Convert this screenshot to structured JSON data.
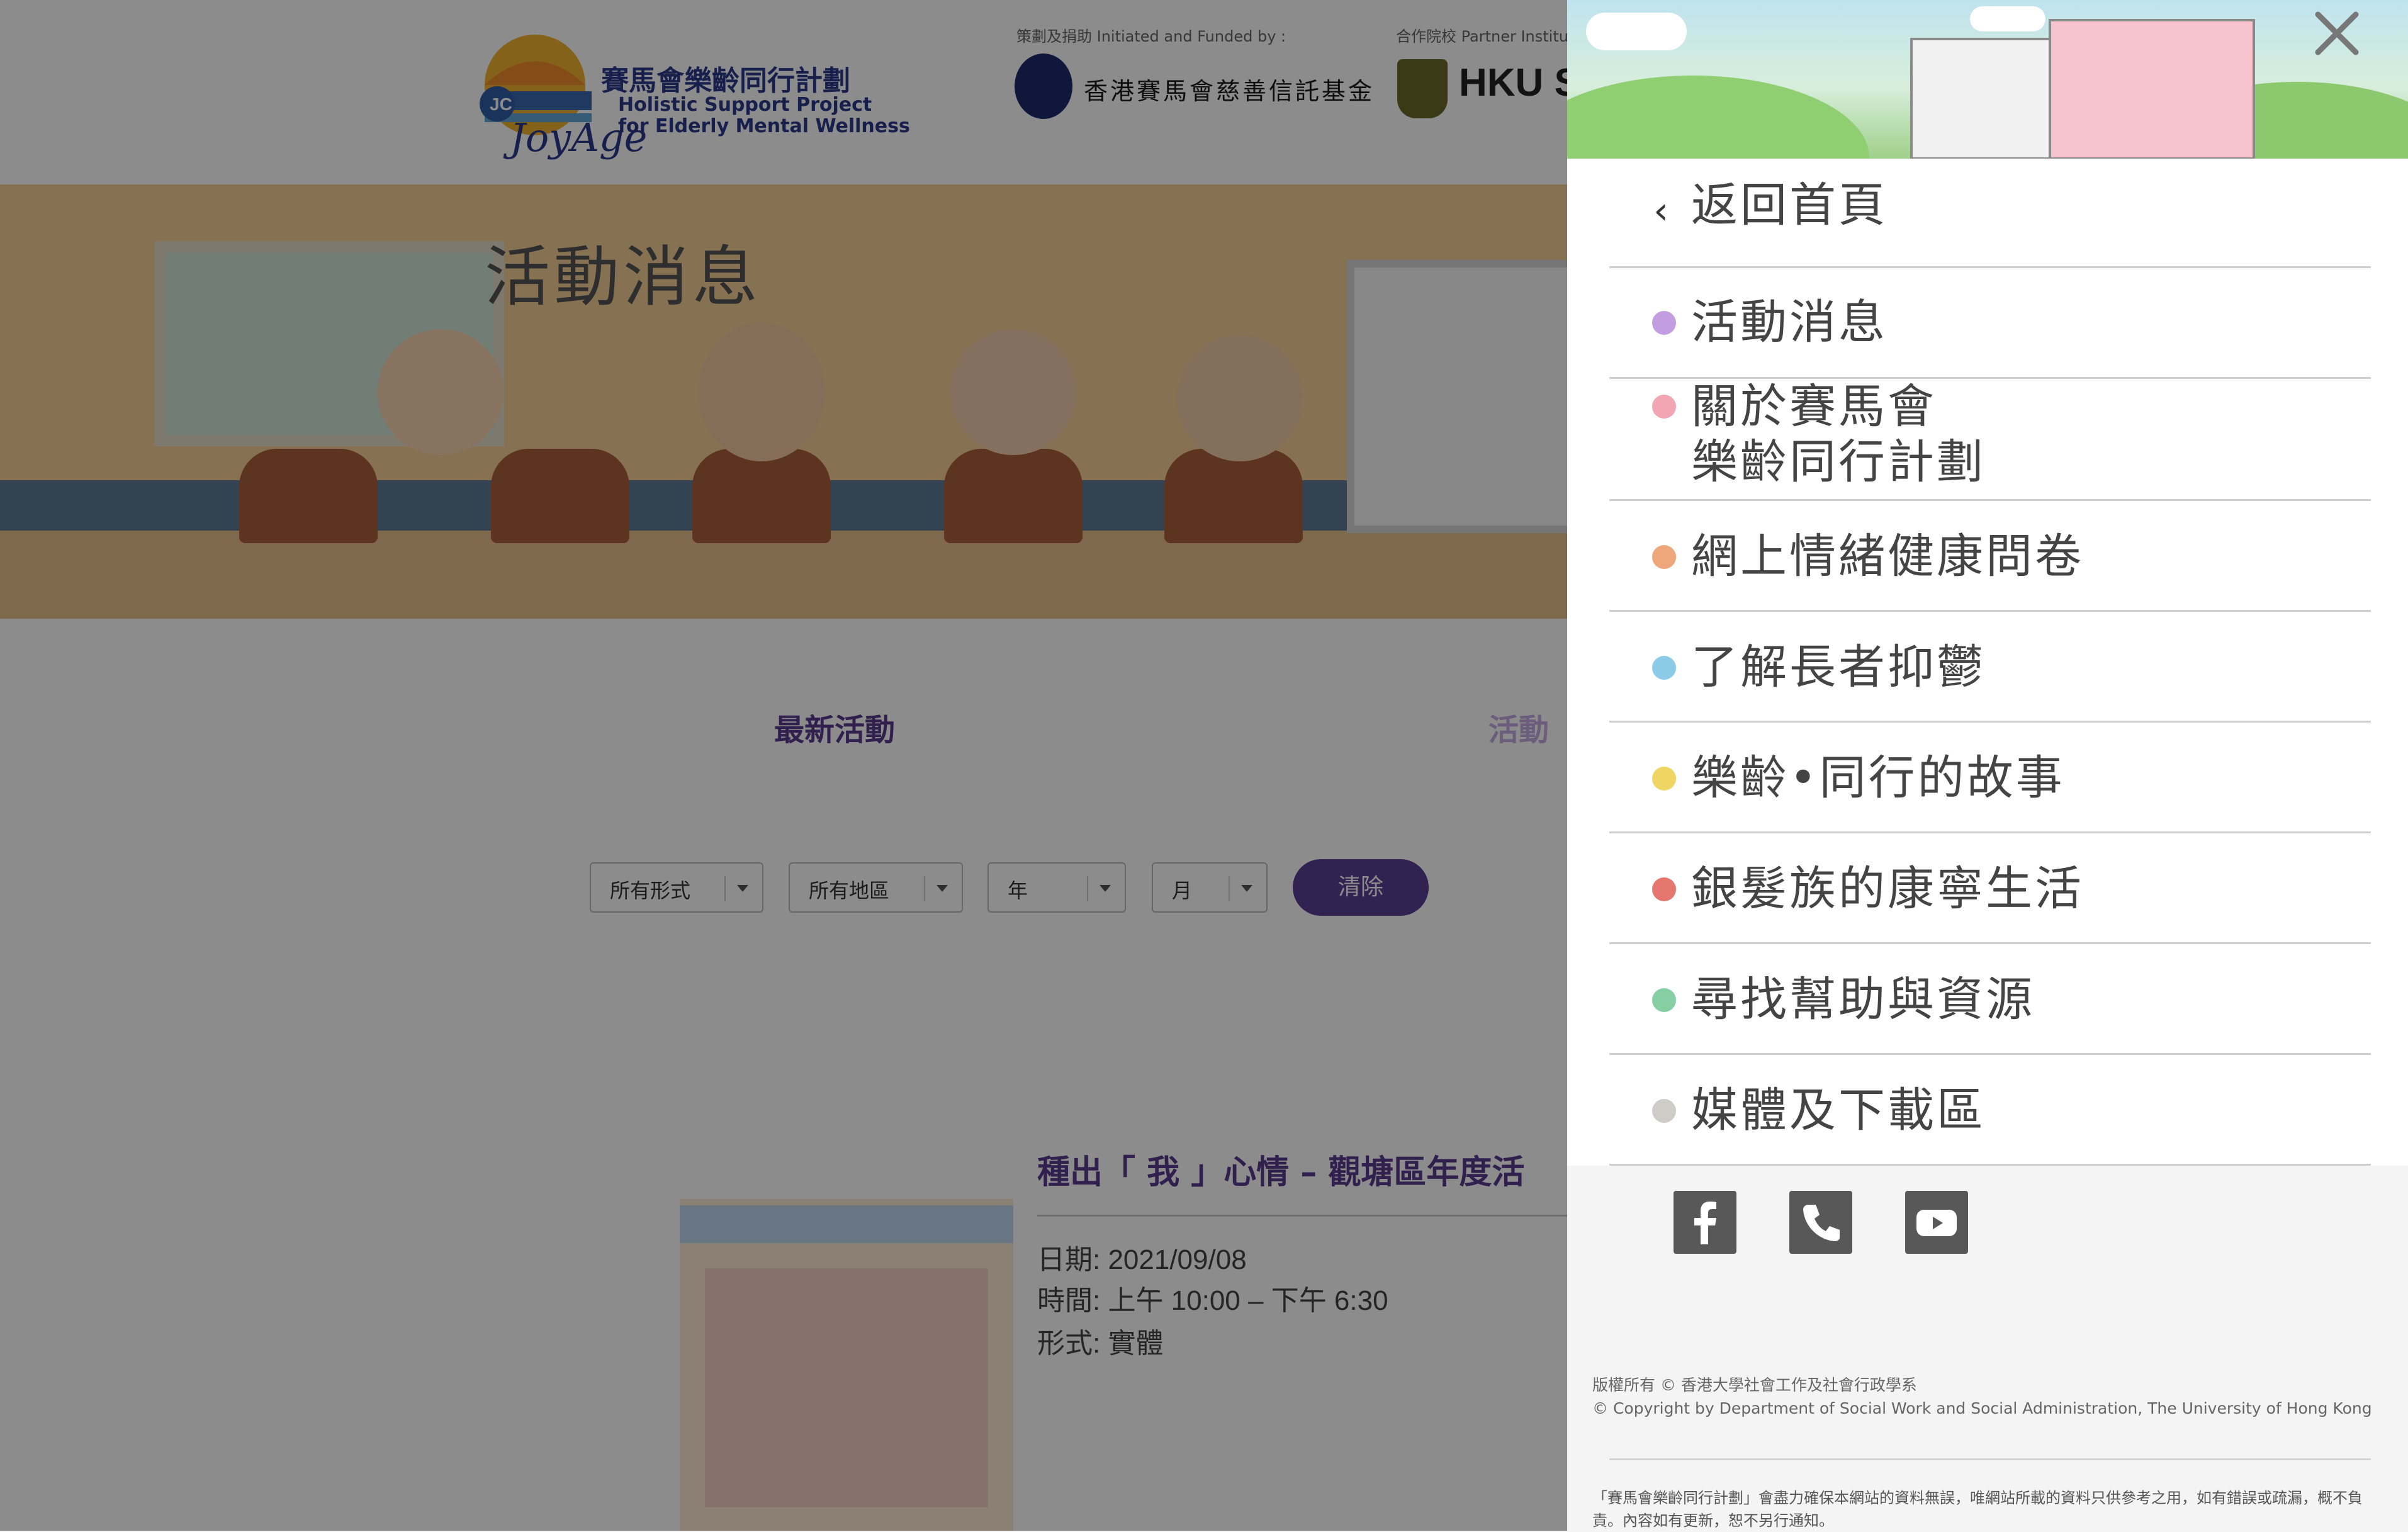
{
  "header": {
    "logo_title": "賽馬會樂齡同行計劃",
    "logo_subtitle_1": "Holistic Support Project",
    "logo_subtitle_2": "for Elderly Mental Wellness",
    "funded_label": "策劃及捐助 Initiated and Funded by :",
    "funder_name": "香港賽馬會慈善信託基金",
    "partner_label": "合作院校 Partner Institutions",
    "partner_name": "HKU SWSA"
  },
  "hero": {
    "title": "活動消息"
  },
  "tabs": [
    {
      "label": "最新活動"
    },
    {
      "label": "活動"
    }
  ],
  "filters": {
    "format": "所有形式",
    "district": "所有地區",
    "year": "年",
    "month": "月",
    "clear_label": "清除"
  },
  "event": {
    "title": "種出「 我 」心情 – 觀塘區年度活",
    "date": "日期: 2021/09/08",
    "time": "時間: 上午 10:00 – 下午 6:30",
    "format": "形式: 實體"
  },
  "menu": {
    "back_label": "返回首頁",
    "items": [
      {
        "line1": "活動消息",
        "dot": "#c29ee0"
      },
      {
        "line1": "關於賽馬會",
        "line2": "樂齡同行計劃",
        "dot": "#f2a5b3"
      },
      {
        "line1": "網上情緒健康問卷",
        "dot": "#eda77a"
      },
      {
        "line1": "了解長者抑鬱",
        "dot": "#8ccbe8"
      },
      {
        "line1": "樂齡•同行的故事",
        "dot": "#eed564"
      },
      {
        "line1": "銀髮族的康寧生活",
        "dot": "#e5776f"
      },
      {
        "line1": "尋找幫助與資源",
        "dot": "#86cfa4"
      },
      {
        "line1": "媒體及下載區",
        "dot": "#cdccc6"
      }
    ]
  },
  "footer": {
    "copyright_zh": "版權所有 © 香港大學社會工作及社會行政學系",
    "copyright_en": "© Copyright by Department of Social Work and Social Administration, The University of Hong Kong",
    "disclaimer": "「賽馬會樂齡同行計劃」會盡力確保本網站的資料無誤，唯網站所載的資料只供參考之用，如有錯誤或疏漏，概不負責。內容如有更新，恕不另行通知。"
  },
  "colors": {
    "accent": "#5a3e96",
    "social_bg": "#585858"
  }
}
